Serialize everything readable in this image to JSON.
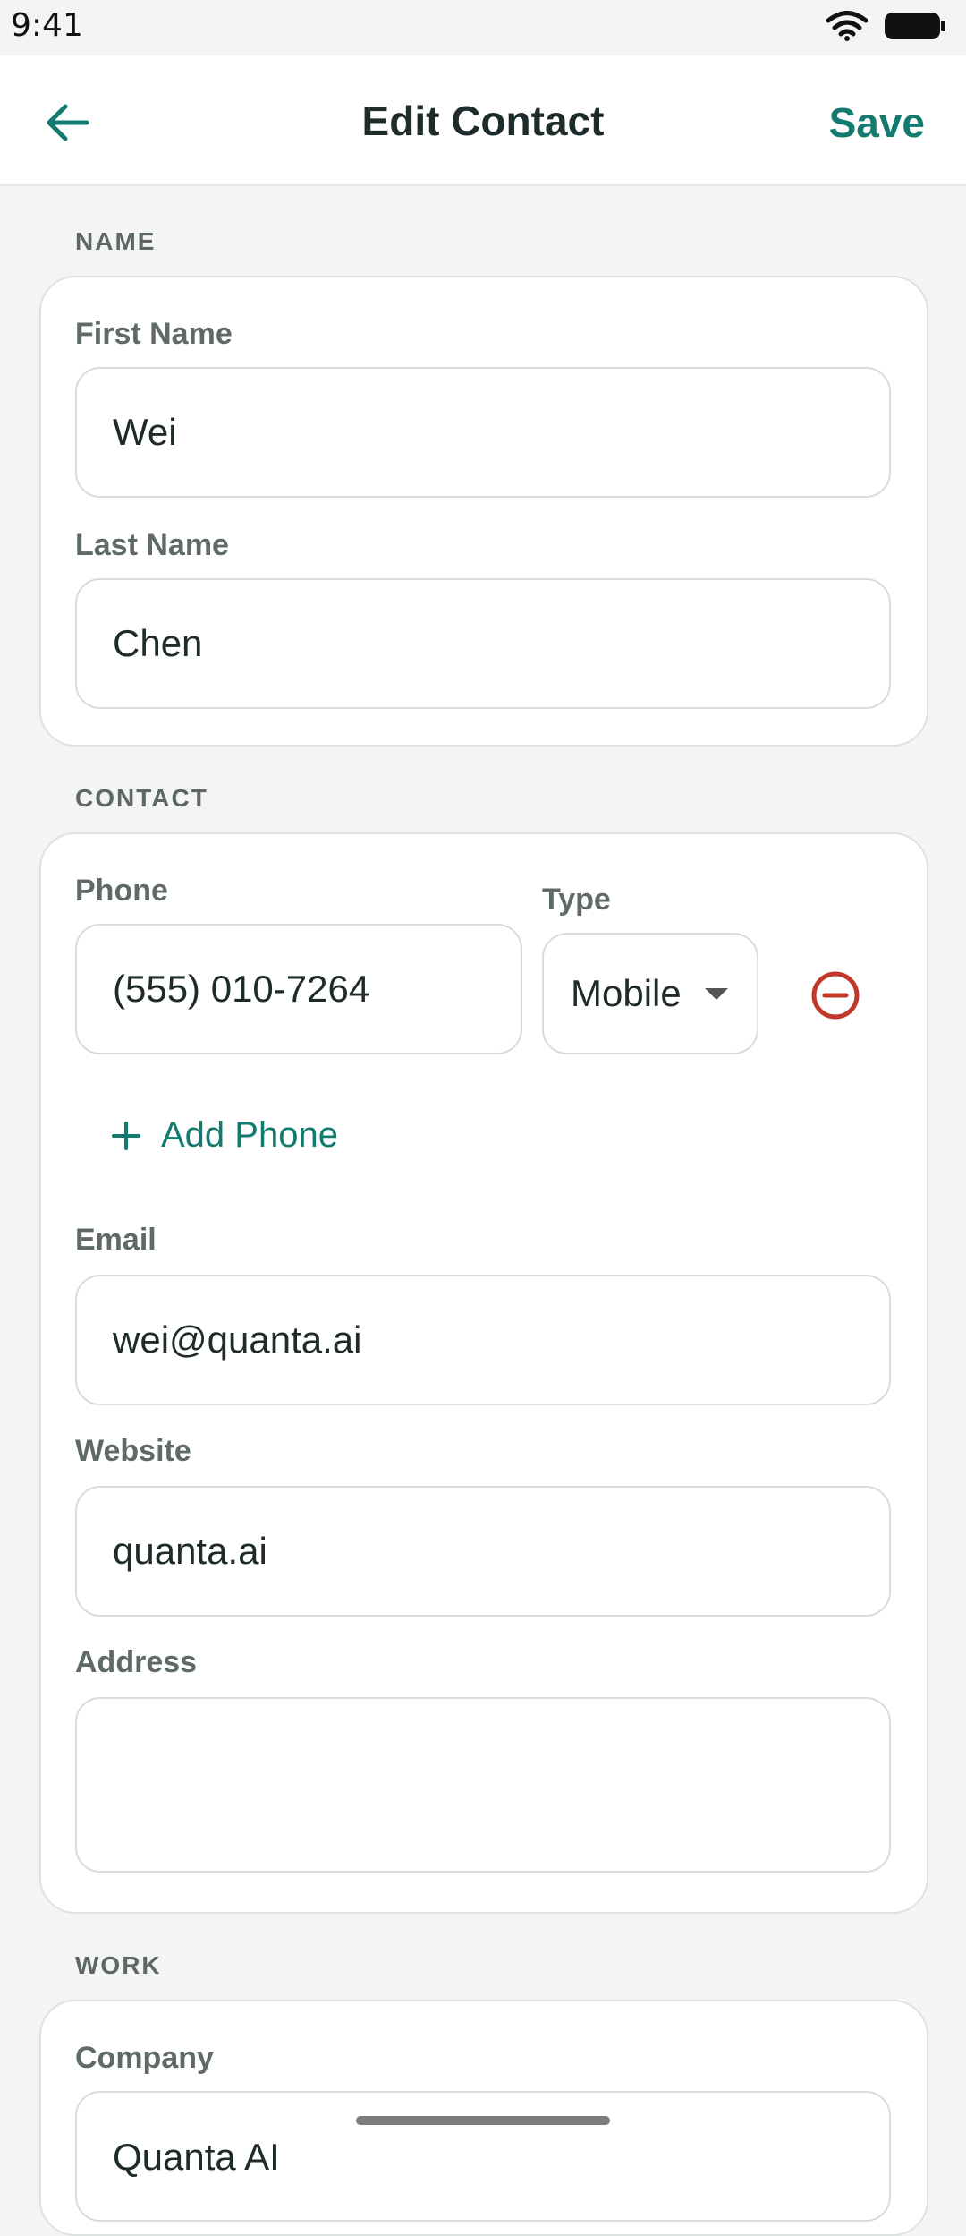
{
  "status": {
    "time": "9:41"
  },
  "header": {
    "title": "Edit Contact",
    "save_label": "Save"
  },
  "sections": {
    "name": {
      "label": "NAME",
      "first_name": {
        "label": "First Name",
        "value": "Wei"
      },
      "last_name": {
        "label": "Last Name",
        "value": "Chen"
      }
    },
    "contact": {
      "label": "CONTACT",
      "phone": {
        "label": "Phone",
        "value": "(555) 010-7264"
      },
      "type": {
        "label": "Type",
        "value": "Mobile"
      },
      "add_phone_label": "Add Phone",
      "email": {
        "label": "Email",
        "value": "wei@quanta.ai"
      },
      "website": {
        "label": "Website",
        "value": "quanta.ai"
      },
      "address": {
        "label": "Address",
        "value": ""
      }
    },
    "work": {
      "label": "WORK",
      "company": {
        "label": "Company",
        "value": "Quanta AI"
      }
    }
  },
  "colors": {
    "accent": "#127a6e",
    "danger": "#c0392b",
    "background": "#f3f4f3"
  }
}
